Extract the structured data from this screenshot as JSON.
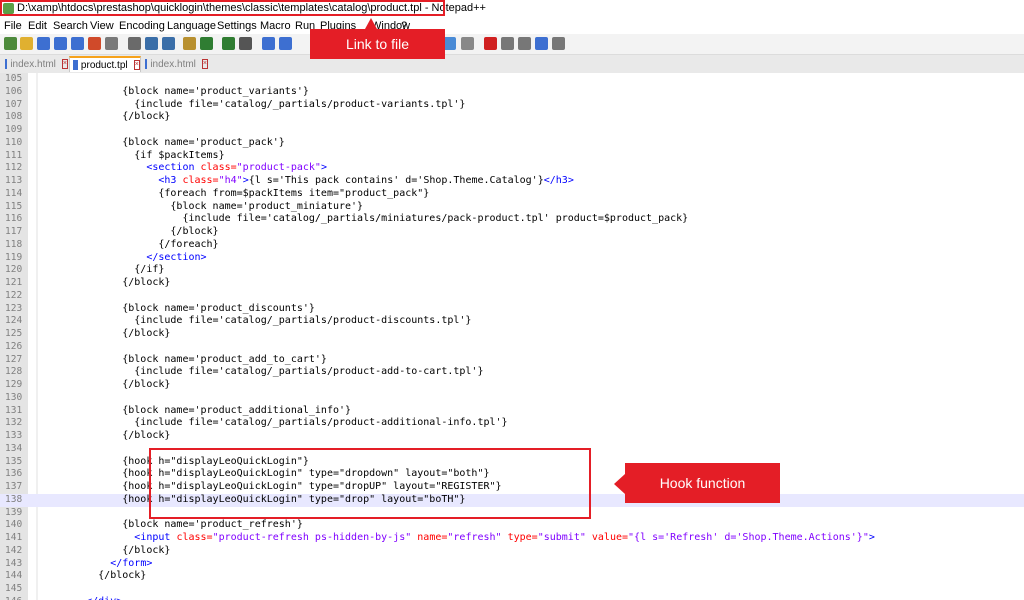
{
  "window": {
    "title": "D:\\xamp\\htdocs\\prestashop\\quicklogin\\themes\\classic\\templates\\catalog\\product.tpl - Notepad++"
  },
  "menu": [
    "File",
    "Edit",
    "Search",
    "View",
    "Encoding",
    "Language",
    "Settings",
    "Macro",
    "Run",
    "Plugins",
    "Window",
    "?"
  ],
  "tabs": [
    {
      "name": "index.html",
      "active": false
    },
    {
      "name": "product.tpl",
      "active": true
    },
    {
      "name": "index.html",
      "active": false
    }
  ],
  "annotations": {
    "link_label": "Link  to file",
    "hook_label": "Hook function"
  },
  "code": {
    "lines": [
      {
        "n": "105",
        "t": ""
      },
      {
        "n": "106",
        "t": "            {block name='product_variants'}"
      },
      {
        "n": "107",
        "t": "              {include file='catalog/_partials/product-variants.tpl'}"
      },
      {
        "n": "108",
        "t": "            {/block}"
      },
      {
        "n": "109",
        "t": ""
      },
      {
        "n": "110",
        "t": "            {block name='product_pack'}"
      },
      {
        "n": "111",
        "t": "              {if $packItems}"
      },
      {
        "n": "112",
        "t": "                <section class=\"product-pack\">"
      },
      {
        "n": "113",
        "t": "                  <h3 class=\"h4\">{l s='This pack contains' d='Shop.Theme.Catalog'}</h3>"
      },
      {
        "n": "114",
        "t": "                  {foreach from=$packItems item=\"product_pack\"}"
      },
      {
        "n": "115",
        "t": "                    {block name='product_miniature'}"
      },
      {
        "n": "116",
        "t": "                      {include file='catalog/_partials/miniatures/pack-product.tpl' product=$product_pack}"
      },
      {
        "n": "117",
        "t": "                    {/block}"
      },
      {
        "n": "118",
        "t": "                  {/foreach}"
      },
      {
        "n": "119",
        "t": "                </section>"
      },
      {
        "n": "120",
        "t": "              {/if}"
      },
      {
        "n": "121",
        "t": "            {/block}"
      },
      {
        "n": "122",
        "t": ""
      },
      {
        "n": "123",
        "t": "            {block name='product_discounts'}"
      },
      {
        "n": "124",
        "t": "              {include file='catalog/_partials/product-discounts.tpl'}"
      },
      {
        "n": "125",
        "t": "            {/block}"
      },
      {
        "n": "126",
        "t": ""
      },
      {
        "n": "127",
        "t": "            {block name='product_add_to_cart'}"
      },
      {
        "n": "128",
        "t": "              {include file='catalog/_partials/product-add-to-cart.tpl'}"
      },
      {
        "n": "129",
        "t": "            {/block}"
      },
      {
        "n": "130",
        "t": ""
      },
      {
        "n": "131",
        "t": "            {block name='product_additional_info'}"
      },
      {
        "n": "132",
        "t": "              {include file='catalog/_partials/product-additional-info.tpl'}"
      },
      {
        "n": "133",
        "t": "            {/block}"
      },
      {
        "n": "134",
        "t": ""
      },
      {
        "n": "135",
        "t": "            {hook h=\"displayLeoQuickLogin\"}"
      },
      {
        "n": "136",
        "t": "            {hook h=\"displayLeoQuickLogin\" type=\"dropdown\" layout=\"both\"}"
      },
      {
        "n": "137",
        "t": "            {hook h=\"displayLeoQuickLogin\" type=\"dropUP\" layout=\"REGISTER\"}"
      },
      {
        "n": "138",
        "t": "            {hook h=\"displayLeoQuickLogin\" type=\"drop\" layout=\"boTH\"}"
      },
      {
        "n": "139",
        "t": ""
      },
      {
        "n": "140",
        "t": "            {block name='product_refresh'}"
      },
      {
        "n": "141",
        "t": "              <input class=\"product-refresh ps-hidden-by-js\" name=\"refresh\" type=\"submit\" value=\"{l s='Refresh' d='Shop.Theme.Actions'}\">"
      },
      {
        "n": "142",
        "t": "            {/block}"
      },
      {
        "n": "143",
        "t": "          </form>"
      },
      {
        "n": "144",
        "t": "        {/block}"
      },
      {
        "n": "145",
        "t": ""
      },
      {
        "n": "146",
        "t": "      </div>"
      }
    ]
  },
  "colors": {
    "annotation_red": "#e41e26",
    "tag_blue": "#0000ff",
    "attr_red": "#ff0000",
    "string_purple": "#8000ff"
  }
}
